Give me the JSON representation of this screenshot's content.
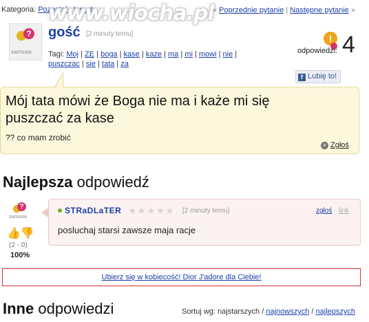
{
  "header": {
    "category_label": "Kategoria:",
    "category_link": "Pozostałe tematy",
    "watermark": "www.wiocha.pl",
    "nav_prev_prefix": "«",
    "nav_prev": "Poprzednie pytanie",
    "nav_sep": "|",
    "nav_next": "Następne pytanie",
    "nav_next_suffix": "»"
  },
  "question": {
    "avatar_text": "samosia",
    "user": "gość",
    "time": "[2 minuty temu]",
    "tags_label": "Tagi:",
    "tags": [
      "Moj",
      "ZE",
      "boga",
      "kase",
      "kaze",
      "ma",
      "mi",
      "mowi",
      "nie",
      "puszczac",
      "sie",
      "tata",
      "za"
    ],
    "answers_label": "odpowiedzi:",
    "answers_count": "4",
    "like_label": "Lubię to!",
    "title": "Mój tata mówi że Boga nie ma i każe mi się puszczać za kase",
    "body": "?? co mam zrobić",
    "report": "Zgłoś"
  },
  "best": {
    "heading_bold": "Najlepsza",
    "heading_rest": "odpowiedź",
    "avatar_text": "samosia",
    "score": "(2 - 0)",
    "percent": "100%",
    "user": "STRaDLaTER",
    "rating_stars": "★★★★★",
    "time": "[2 minuty temu]",
    "report": "zgłoś",
    "link": "link",
    "text": "posluchaj starsi zawsze maja racje"
  },
  "ad": {
    "text": "Ubierz się w kobiecość! Dior J'adore dla Ciebie!"
  },
  "other": {
    "heading_bold": "Inne",
    "heading_rest": "odpowiedzi",
    "sort_label": "Sortuj wg: najstarszych /",
    "sort_newest": "najnowszych",
    "sort_sep": "/",
    "sort_best": "najlepszych"
  }
}
